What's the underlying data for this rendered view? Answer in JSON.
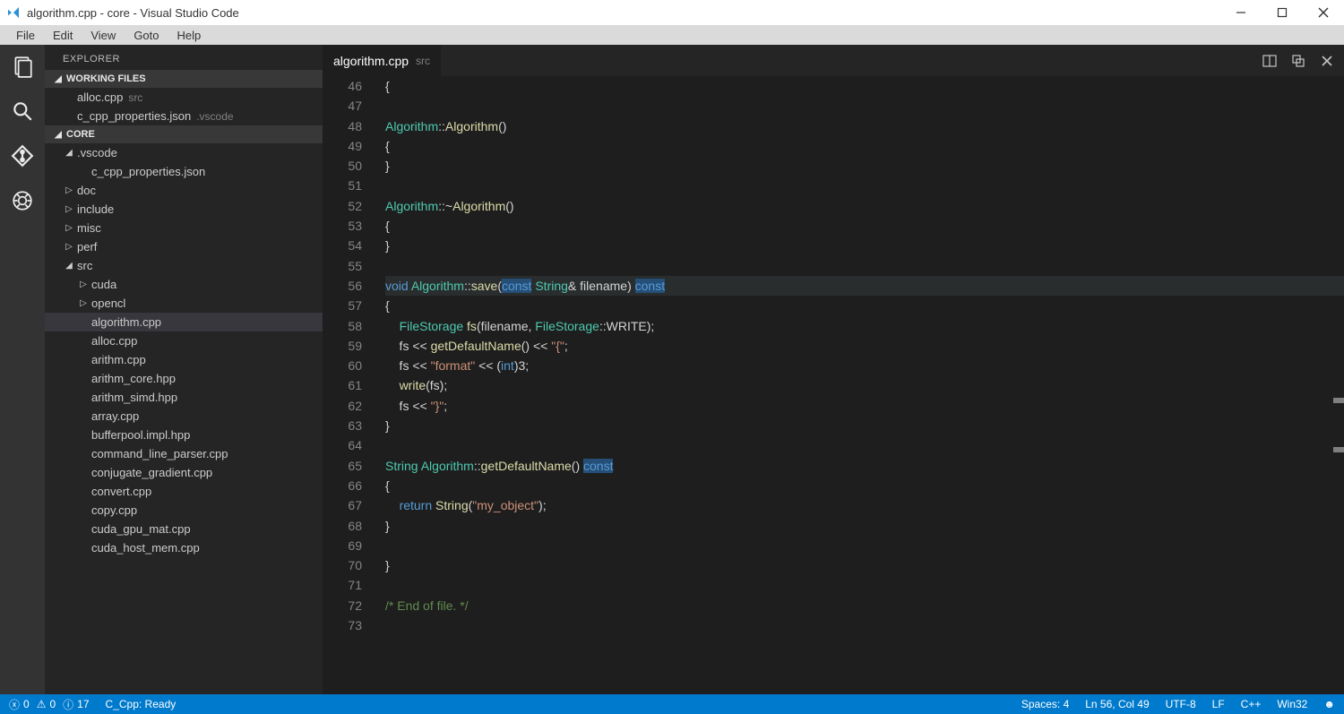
{
  "window": {
    "title": "algorithm.cpp - core - Visual Studio Code"
  },
  "menu": [
    "File",
    "Edit",
    "View",
    "Goto",
    "Help"
  ],
  "sidebar": {
    "title": "EXPLORER",
    "workingFilesLabel": "WORKING FILES",
    "workingFiles": [
      {
        "name": "alloc.cpp",
        "dir": "src"
      },
      {
        "name": "c_cpp_properties.json",
        "dir": ".vscode"
      }
    ],
    "projectLabel": "CORE",
    "tree": [
      {
        "label": ".vscode",
        "kind": "folder",
        "expanded": true,
        "depth": 0
      },
      {
        "label": "c_cpp_properties.json",
        "kind": "file",
        "depth": 1
      },
      {
        "label": "doc",
        "kind": "folder",
        "expanded": false,
        "depth": 0
      },
      {
        "label": "include",
        "kind": "folder",
        "expanded": false,
        "depth": 0
      },
      {
        "label": "misc",
        "kind": "folder",
        "expanded": false,
        "depth": 0
      },
      {
        "label": "perf",
        "kind": "folder",
        "expanded": false,
        "depth": 0
      },
      {
        "label": "src",
        "kind": "folder",
        "expanded": true,
        "depth": 0
      },
      {
        "label": "cuda",
        "kind": "folder",
        "expanded": false,
        "depth": 1
      },
      {
        "label": "opencl",
        "kind": "folder",
        "expanded": false,
        "depth": 1
      },
      {
        "label": "algorithm.cpp",
        "kind": "file",
        "depth": 1,
        "selected": true
      },
      {
        "label": "alloc.cpp",
        "kind": "file",
        "depth": 1
      },
      {
        "label": "arithm.cpp",
        "kind": "file",
        "depth": 1
      },
      {
        "label": "arithm_core.hpp",
        "kind": "file",
        "depth": 1
      },
      {
        "label": "arithm_simd.hpp",
        "kind": "file",
        "depth": 1
      },
      {
        "label": "array.cpp",
        "kind": "file",
        "depth": 1
      },
      {
        "label": "bufferpool.impl.hpp",
        "kind": "file",
        "depth": 1
      },
      {
        "label": "command_line_parser.cpp",
        "kind": "file",
        "depth": 1
      },
      {
        "label": "conjugate_gradient.cpp",
        "kind": "file",
        "depth": 1
      },
      {
        "label": "convert.cpp",
        "kind": "file",
        "depth": 1
      },
      {
        "label": "copy.cpp",
        "kind": "file",
        "depth": 1
      },
      {
        "label": "cuda_gpu_mat.cpp",
        "kind": "file",
        "depth": 1
      },
      {
        "label": "cuda_host_mem.cpp",
        "kind": "file",
        "depth": 1
      }
    ]
  },
  "tab": {
    "name": "algorithm.cpp",
    "dir": "src"
  },
  "code": {
    "firstLine": 46,
    "lines": [
      {
        "tokens": [
          [
            "punc",
            "{"
          ]
        ]
      },
      {
        "tokens": []
      },
      {
        "tokens": [
          [
            "cls",
            "Algorithm"
          ],
          [
            "punc",
            "::"
          ],
          [
            "fn",
            "Algorithm"
          ],
          [
            "punc",
            "()"
          ]
        ]
      },
      {
        "tokens": [
          [
            "punc",
            "{"
          ]
        ]
      },
      {
        "tokens": [
          [
            "punc",
            "}"
          ]
        ]
      },
      {
        "tokens": []
      },
      {
        "tokens": [
          [
            "cls",
            "Algorithm"
          ],
          [
            "punc",
            "::~"
          ],
          [
            "fn",
            "Algorithm"
          ],
          [
            "punc",
            "()"
          ]
        ]
      },
      {
        "tokens": [
          [
            "punc",
            "{"
          ]
        ]
      },
      {
        "tokens": [
          [
            "punc",
            "}"
          ]
        ]
      },
      {
        "tokens": []
      },
      {
        "hl": true,
        "tokens": [
          [
            "kw",
            "void"
          ],
          [
            "punc",
            " "
          ],
          [
            "cls",
            "Algorithm"
          ],
          [
            "punc",
            "::"
          ],
          [
            "fn",
            "save"
          ],
          [
            "punc",
            "("
          ],
          [
            "hlkw",
            "const"
          ],
          [
            "punc",
            " "
          ],
          [
            "type",
            "String"
          ],
          [
            "punc",
            "& filename) "
          ],
          [
            "hlkw",
            "const"
          ]
        ]
      },
      {
        "tokens": [
          [
            "punc",
            "{"
          ]
        ]
      },
      {
        "tokens": [
          [
            "punc",
            "    "
          ],
          [
            "type",
            "FileStorage"
          ],
          [
            "punc",
            " "
          ],
          [
            "fn",
            "fs"
          ],
          [
            "punc",
            "(filename, "
          ],
          [
            "type",
            "FileStorage"
          ],
          [
            "punc",
            "::WRITE);"
          ]
        ]
      },
      {
        "tokens": [
          [
            "punc",
            "    fs << "
          ],
          [
            "fn",
            "getDefaultName"
          ],
          [
            "punc",
            "() << "
          ],
          [
            "str",
            "\"{\""
          ],
          [
            "punc",
            ";"
          ]
        ]
      },
      {
        "tokens": [
          [
            "punc",
            "    fs << "
          ],
          [
            "str",
            "\"format\""
          ],
          [
            "punc",
            " << ("
          ],
          [
            "kw",
            "int"
          ],
          [
            "punc",
            ")3;"
          ]
        ]
      },
      {
        "tokens": [
          [
            "punc",
            "    "
          ],
          [
            "fn",
            "write"
          ],
          [
            "punc",
            "(fs);"
          ]
        ]
      },
      {
        "tokens": [
          [
            "punc",
            "    fs << "
          ],
          [
            "str",
            "\"}\""
          ],
          [
            "punc",
            ";"
          ]
        ]
      },
      {
        "tokens": [
          [
            "punc",
            "}"
          ]
        ]
      },
      {
        "tokens": []
      },
      {
        "tokens": [
          [
            "type",
            "String"
          ],
          [
            "punc",
            " "
          ],
          [
            "cls",
            "Algorithm"
          ],
          [
            "punc",
            "::"
          ],
          [
            "fn",
            "getDefaultName"
          ],
          [
            "punc",
            "() "
          ],
          [
            "hlkw",
            "const"
          ]
        ]
      },
      {
        "tokens": [
          [
            "punc",
            "{"
          ]
        ]
      },
      {
        "tokens": [
          [
            "punc",
            "    "
          ],
          [
            "kw",
            "return"
          ],
          [
            "punc",
            " "
          ],
          [
            "fn",
            "String"
          ],
          [
            "punc",
            "("
          ],
          [
            "str",
            "\"my_object\""
          ],
          [
            "punc",
            ");"
          ]
        ]
      },
      {
        "tokens": [
          [
            "punc",
            "}"
          ]
        ]
      },
      {
        "tokens": []
      },
      {
        "tokens": [
          [
            "punc",
            "}"
          ]
        ]
      },
      {
        "tokens": []
      },
      {
        "tokens": [
          [
            "cmt",
            "/* End of file. */"
          ]
        ]
      },
      {
        "tokens": []
      }
    ]
  },
  "status": {
    "errors": "0",
    "warnings": "0",
    "info": "17",
    "cppStatus": "C_Cpp: Ready",
    "spaces": "Spaces: 4",
    "cursor": "Ln 56, Col 49",
    "encoding": "UTF-8",
    "eol": "LF",
    "lang": "C++",
    "os": "Win32"
  }
}
